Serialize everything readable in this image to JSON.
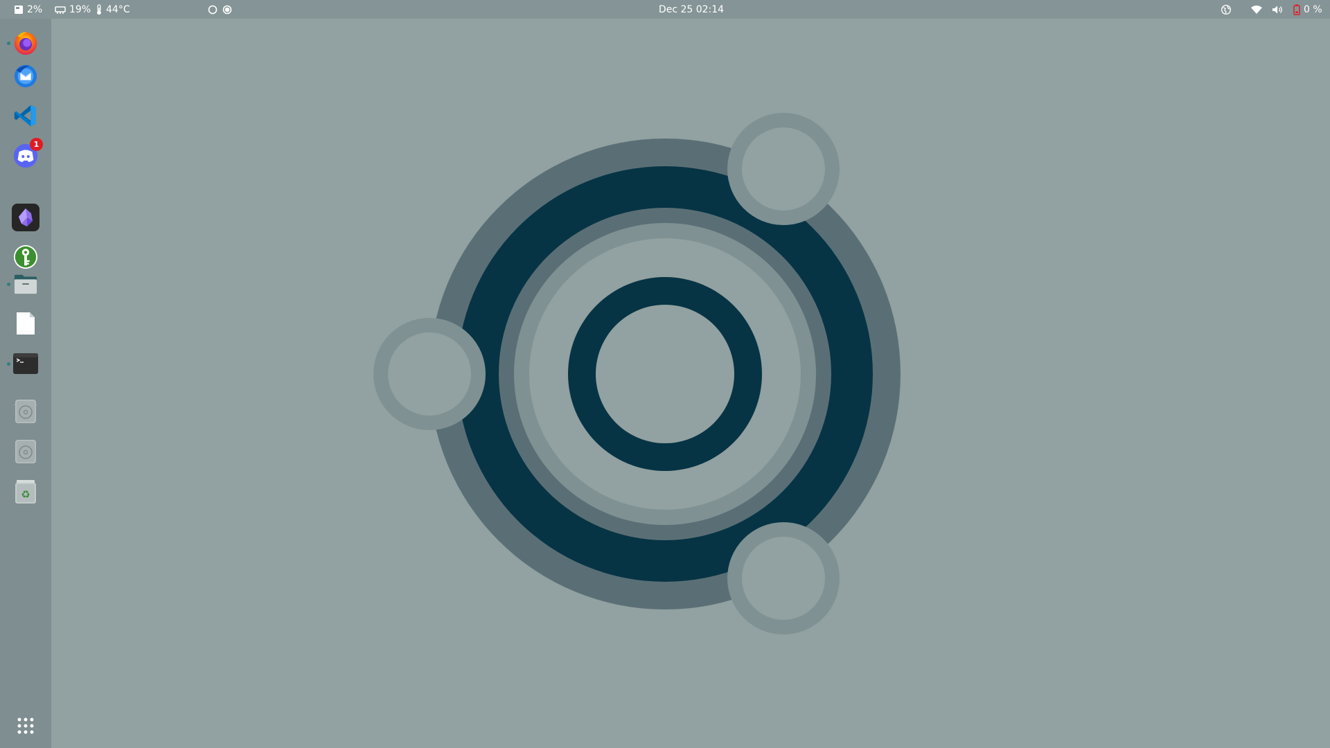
{
  "topbar": {
    "disk_usage": "2%",
    "memory_usage": "19%",
    "cpu_temp": "44°C",
    "clock": "Dec 25  02:14",
    "battery": "0 %"
  },
  "dock": {
    "items": [
      {
        "name": "Firefox",
        "icon": "firefox-icon",
        "running": true
      },
      {
        "name": "Thunderbird",
        "icon": "thunderbird-icon",
        "running": false
      },
      {
        "name": "Visual Studio Code",
        "icon": "vscode-icon",
        "running": false
      },
      {
        "name": "Discord",
        "icon": "discord-icon",
        "running": false,
        "badge": "1"
      },
      {
        "name": "Obsidian",
        "icon": "obsidian-icon",
        "running": false
      },
      {
        "name": "KeePassXC",
        "icon": "keepassxc-icon",
        "running": false
      },
      {
        "name": "Files",
        "icon": "files-icon",
        "running": true
      },
      {
        "name": "Text Editor",
        "icon": "document-icon",
        "running": false
      },
      {
        "name": "Terminal",
        "icon": "terminal-icon",
        "running": true
      },
      {
        "name": "Drive 1",
        "icon": "drive-icon",
        "running": false
      },
      {
        "name": "Drive 2",
        "icon": "drive-icon",
        "running": false
      },
      {
        "name": "Trash",
        "icon": "trash-icon",
        "running": false
      },
      {
        "name": "Show Applications",
        "icon": "app-grid-icon",
        "running": false
      }
    ]
  },
  "colors": {
    "wallpaper_bg": "#92a1a1",
    "topbar_bg": "#859496",
    "dock_bg": "#7f8e90",
    "ring_dark": "#063445",
    "ring_mid": "#5a6f75",
    "ring_light": "#7f9193",
    "battery_alert": "#e01b24"
  }
}
